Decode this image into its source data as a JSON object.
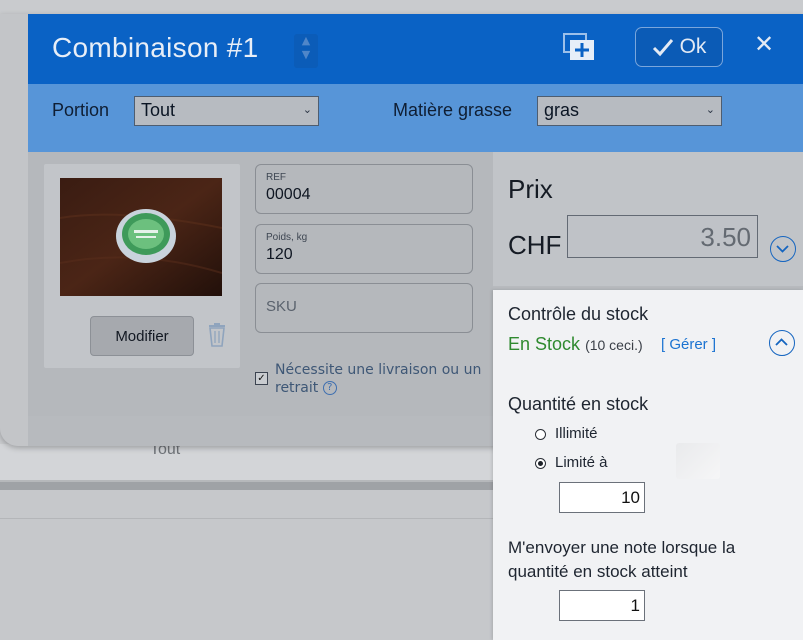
{
  "modal": {
    "title": "Combinaison #1",
    "ok_label": "Ok",
    "close_glyph": "✕",
    "colors": {
      "header": "#0a62c5",
      "options_bar": "#5795d8",
      "stock_green": "#2f8a2f",
      "link_blue": "#1b73d1"
    }
  },
  "options": {
    "portion_label": "Portion",
    "portion_value": "Tout",
    "fat_label": "Matière grasse",
    "fat_value": "gras"
  },
  "product": {
    "modify_label": "Modifier",
    "trash_icon": "trash-icon",
    "ref_label": "REF",
    "ref_value": "00004",
    "weight_label": "Poids, kg",
    "weight_value": "120",
    "sku_placeholder": "SKU",
    "shipping_checked": true,
    "shipping_label": "Nécessite une livraison ou un retrait",
    "help_glyph": "?"
  },
  "price": {
    "title": "Prix",
    "currency": "CHF",
    "value": "3.50"
  },
  "stock": {
    "title": "Contrôle du stock",
    "status": "En Stock",
    "count": "(10 ceci.)",
    "manage_link": "[ Gérer ]",
    "qty_title": "Quantité en stock",
    "unlimited_label": "Illimité",
    "limited_label": "Limité à",
    "selected": "limited",
    "limit_value": "10",
    "note_label": "M'envoyer une note lorsque la quantité en stock atteint",
    "threshold_value": "1"
  },
  "background": {
    "portion_text": "Tout"
  }
}
